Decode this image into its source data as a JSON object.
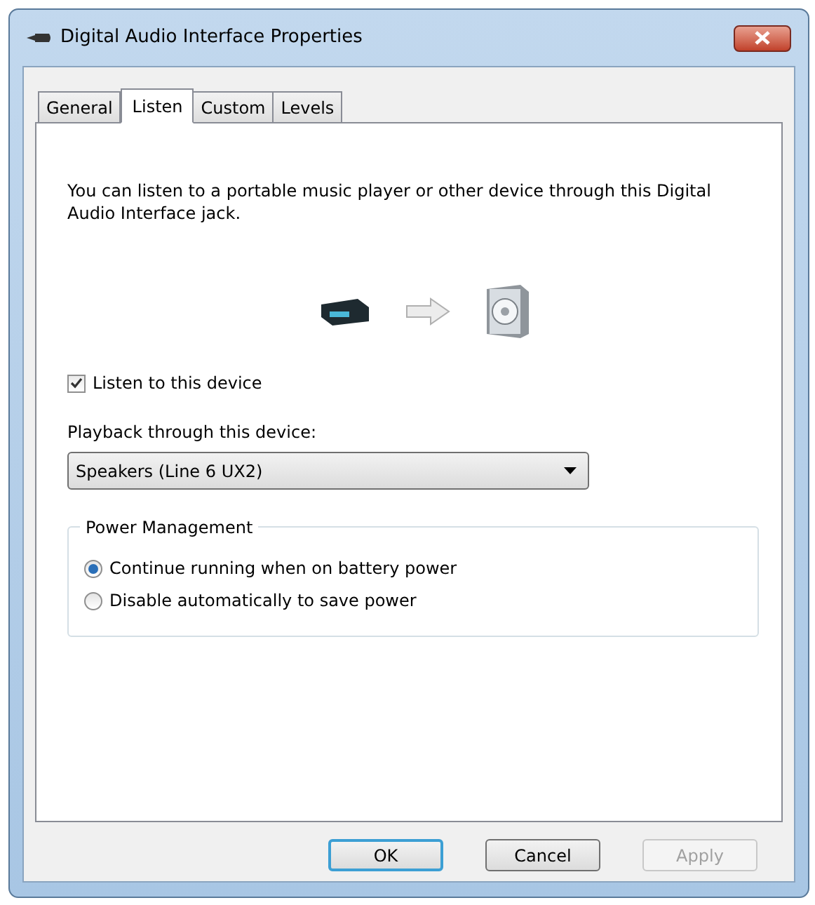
{
  "window": {
    "title": "Digital Audio Interface Properties"
  },
  "tabs": [
    {
      "label": "General",
      "selected": false
    },
    {
      "label": "Listen",
      "selected": true
    },
    {
      "label": "Custom",
      "selected": false
    },
    {
      "label": "Levels",
      "selected": false
    }
  ],
  "description": "You can listen to a portable music player or other device through this Digital Audio Interface jack.",
  "listen_checkbox": {
    "label": "Listen to this device",
    "checked": true
  },
  "playback": {
    "label": "Playback through this device:",
    "value": "Speakers (Line 6 UX2)"
  },
  "power_management": {
    "title": "Power Management",
    "options": [
      {
        "label": "Continue running when on battery power",
        "selected": true
      },
      {
        "label": "Disable automatically to save power",
        "selected": false
      }
    ]
  },
  "buttons": [
    {
      "label": "OK",
      "default": true,
      "disabled": false
    },
    {
      "label": "Cancel",
      "default": false,
      "disabled": false
    },
    {
      "label": "Apply",
      "default": false,
      "disabled": true
    }
  ]
}
